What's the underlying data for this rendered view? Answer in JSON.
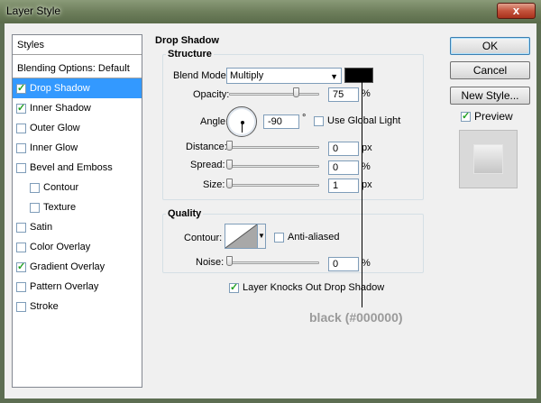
{
  "window": {
    "title": "Layer Style",
    "close_label": "x"
  },
  "styles_panel": {
    "header": "Styles",
    "blending_options": "Blending Options: Default",
    "items": [
      {
        "label": "Drop Shadow",
        "checked": true,
        "selected": true,
        "indent": false
      },
      {
        "label": "Inner Shadow",
        "checked": true,
        "selected": false,
        "indent": false
      },
      {
        "label": "Outer Glow",
        "checked": false,
        "selected": false,
        "indent": false
      },
      {
        "label": "Inner Glow",
        "checked": false,
        "selected": false,
        "indent": false
      },
      {
        "label": "Bevel and Emboss",
        "checked": false,
        "selected": false,
        "indent": false
      },
      {
        "label": "Contour",
        "checked": false,
        "selected": false,
        "indent": true
      },
      {
        "label": "Texture",
        "checked": false,
        "selected": false,
        "indent": true
      },
      {
        "label": "Satin",
        "checked": false,
        "selected": false,
        "indent": false
      },
      {
        "label": "Color Overlay",
        "checked": false,
        "selected": false,
        "indent": false
      },
      {
        "label": "Gradient Overlay",
        "checked": true,
        "selected": false,
        "indent": false
      },
      {
        "label": "Pattern Overlay",
        "checked": false,
        "selected": false,
        "indent": false
      },
      {
        "label": "Stroke",
        "checked": false,
        "selected": false,
        "indent": false
      }
    ]
  },
  "buttons": {
    "ok": "OK",
    "cancel": "Cancel",
    "new_style": "New Style...",
    "preview": "Preview",
    "preview_checked": true
  },
  "drop_shadow": {
    "section_title": "Drop Shadow",
    "structure": {
      "title": "Structure",
      "blend_mode_label": "Blend Mode:",
      "blend_mode_value": "Multiply",
      "shadow_color": "#000000",
      "opacity_label": "Opacity:",
      "opacity_value": "75",
      "opacity_unit": "%",
      "opacity_level": 0.75,
      "angle_label": "Angle:",
      "angle_value": "-90",
      "angle_unit": "°",
      "use_global_light_label": "Use Global Light",
      "use_global_light_checked": false,
      "distance_label": "Distance:",
      "distance_value": "0",
      "distance_unit": "px",
      "spread_label": "Spread:",
      "spread_value": "0",
      "spread_unit": "%",
      "size_label": "Size:",
      "size_value": "1",
      "size_unit": "px"
    },
    "quality": {
      "title": "Quality",
      "contour_label": "Contour:",
      "anti_aliased_label": "Anti-aliased",
      "anti_aliased_checked": false,
      "noise_label": "Noise:",
      "noise_value": "0",
      "noise_unit": "%"
    },
    "knockout_label": "Layer Knocks Out Drop Shadow",
    "knockout_checked": true
  },
  "annotation": {
    "text": "black (#000000)"
  },
  "colors": {
    "selection": "#3399ff",
    "dialog_bg": "#f0f0f0",
    "annotation_text": "#9a9a9a"
  }
}
